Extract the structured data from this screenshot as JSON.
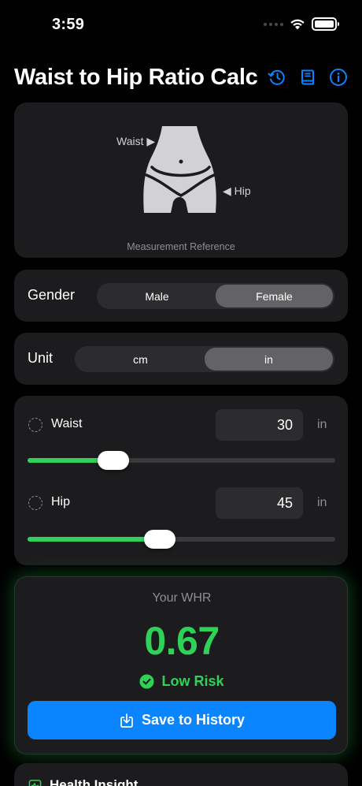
{
  "status_bar": {
    "time": "3:59"
  },
  "header": {
    "title": "Waist to Hip Ratio Calc",
    "icons": [
      "history-icon",
      "book-icon",
      "info-icon"
    ],
    "accent": "#0a84ff"
  },
  "illustration": {
    "waist_label": "Waist ▶",
    "hip_label": "◀ Hip",
    "caption": "Measurement Reference"
  },
  "gender": {
    "label": "Gender",
    "options": [
      "Male",
      "Female"
    ],
    "selected": "Female"
  },
  "unit": {
    "label": "Unit",
    "options": [
      "cm",
      "in"
    ],
    "selected": "in"
  },
  "measurements": {
    "waist": {
      "label": "Waist",
      "value": "30",
      "unit": "in",
      "slider_fraction": 0.28
    },
    "hip": {
      "label": "Hip",
      "value": "45",
      "unit": "in",
      "slider_fraction": 0.43
    }
  },
  "result": {
    "label": "Your WHR",
    "value": "0.67",
    "risk": "Low Risk",
    "save_label": "Save to History",
    "color": "#30d158"
  },
  "insight": {
    "title": "Health Insight"
  }
}
